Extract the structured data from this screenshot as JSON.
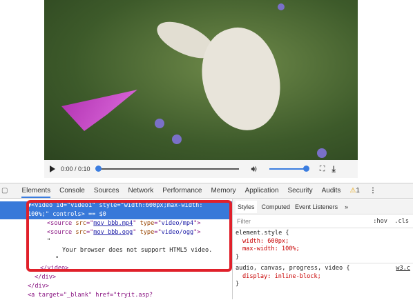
{
  "player": {
    "time": "0:00 / 0:10",
    "progress": 0,
    "volume": 1
  },
  "devtools": {
    "tabs": [
      "Elements",
      "Console",
      "Sources",
      "Network",
      "Performance",
      "Memory",
      "Application",
      "Security",
      "Audits"
    ],
    "warnings": "1"
  },
  "elements": {
    "line1a": "▼<video id=\"video1\" style=\"width:600px;max-width:",
    "line1b": "100%;\" controls> == $0",
    "src1": "mov_bbb.mp4",
    "type1": "video/mp4",
    "src2": "mov_bbb.ogg",
    "type2": "video/ogg",
    "quote": "\"",
    "text": "Your browser does not support HTML5 video.",
    "close": "</video>",
    "div_close1": "</div>",
    "div_close2": "</div>",
    "a_line": "<a target=\"_blank\" href=\"tryit.asp?"
  },
  "styles": {
    "tabs": [
      "Styles",
      "Computed",
      "Event Listeners",
      "»"
    ],
    "filter": "Filter",
    "hov": ":hov",
    "cls": ".cls",
    "rule1": "element.style {",
    "p1": "width: 600px;",
    "p2": "max-width: 100%;",
    "close": "}",
    "rule2": "audio, canvas, progress, video {",
    "src": "w3.c",
    "p3": "display: inline-block;"
  }
}
